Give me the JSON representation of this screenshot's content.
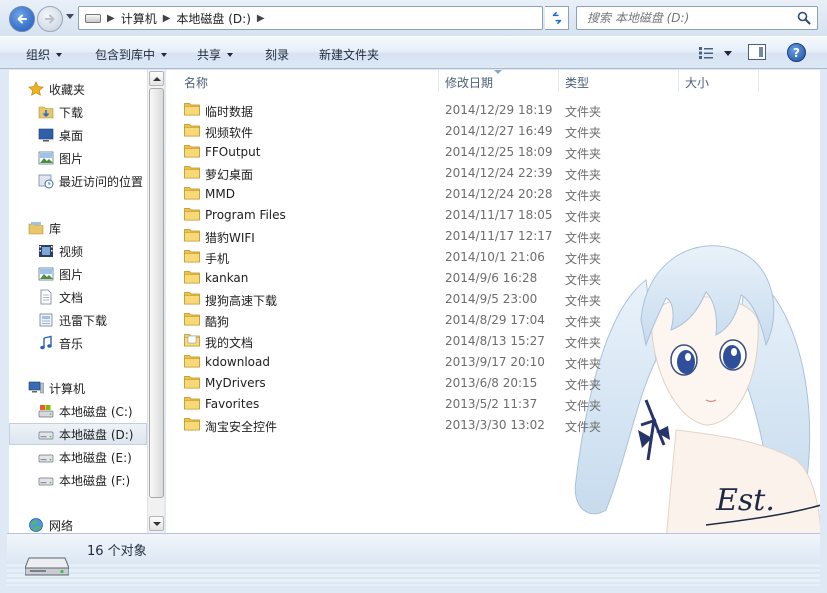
{
  "address_bar": {
    "crumbs": [
      "计算机",
      "本地磁盘 (D:)"
    ],
    "search_placeholder": "搜索 本地磁盘 (D:)"
  },
  "toolbar": {
    "organize": "组织",
    "include_in_library": "包含到库中",
    "share": "共享",
    "burn": "刻录",
    "new_folder": "新建文件夹"
  },
  "nav": {
    "favorites": "收藏夹",
    "favorites_items": [
      "下载",
      "桌面",
      "图片",
      "最近访问的位置"
    ],
    "libraries": "库",
    "library_items": [
      "视频",
      "图片",
      "文档",
      "迅雷下载",
      "音乐"
    ],
    "computer": "计算机",
    "computer_items": [
      "本地磁盘 (C:)",
      "本地磁盘 (D:)",
      "本地磁盘 (E:)",
      "本地磁盘 (F:)"
    ],
    "network": "网络",
    "selected": "本地磁盘 (D:)"
  },
  "columns": {
    "name": "名称",
    "date": "修改日期",
    "type": "类型",
    "size": "大小"
  },
  "files": [
    {
      "name": "临时数据",
      "date": "2014/12/29 18:19",
      "type": "文件夹",
      "icon": "folder-icon"
    },
    {
      "name": "视频软件",
      "date": "2014/12/27 16:49",
      "type": "文件夹",
      "icon": "folder-icon"
    },
    {
      "name": "FFOutput",
      "date": "2014/12/25 18:09",
      "type": "文件夹",
      "icon": "folder-icon"
    },
    {
      "name": "萝幻桌面",
      "date": "2014/12/24 22:39",
      "type": "文件夹",
      "icon": "folder-icon"
    },
    {
      "name": "MMD",
      "date": "2014/12/24 20:28",
      "type": "文件夹",
      "icon": "folder-icon"
    },
    {
      "name": "Program Files",
      "date": "2014/11/17 18:05",
      "type": "文件夹",
      "icon": "folder-icon"
    },
    {
      "name": "猎豹WIFI",
      "date": "2014/11/17 12:17",
      "type": "文件夹",
      "icon": "folder-icon"
    },
    {
      "name": "手机",
      "date": "2014/10/1 21:06",
      "type": "文件夹",
      "icon": "folder-icon"
    },
    {
      "name": "kankan",
      "date": "2014/9/6 16:28",
      "type": "文件夹",
      "icon": "folder-icon"
    },
    {
      "name": "搜狗高速下载",
      "date": "2014/9/5 23:00",
      "type": "文件夹",
      "icon": "folder-icon"
    },
    {
      "name": "酷狗",
      "date": "2014/8/29 17:04",
      "type": "文件夹",
      "icon": "folder-icon"
    },
    {
      "name": "我的文档",
      "date": "2014/8/13 15:27",
      "type": "文件夹",
      "icon": "documents-folder-icon"
    },
    {
      "name": "kdownload",
      "date": "2013/9/17 20:10",
      "type": "文件夹",
      "icon": "folder-icon"
    },
    {
      "name": "MyDrivers",
      "date": "2013/6/8 20:15",
      "type": "文件夹",
      "icon": "folder-icon"
    },
    {
      "name": "Favorites",
      "date": "2013/5/2 11:37",
      "type": "文件夹",
      "icon": "folder-icon"
    },
    {
      "name": "淘宝安全控件",
      "date": "2013/3/30 13:02",
      "type": "文件夹",
      "icon": "folder-icon"
    }
  ],
  "details": {
    "count": "16 个对象"
  },
  "artwork": {
    "signature": "Est."
  }
}
